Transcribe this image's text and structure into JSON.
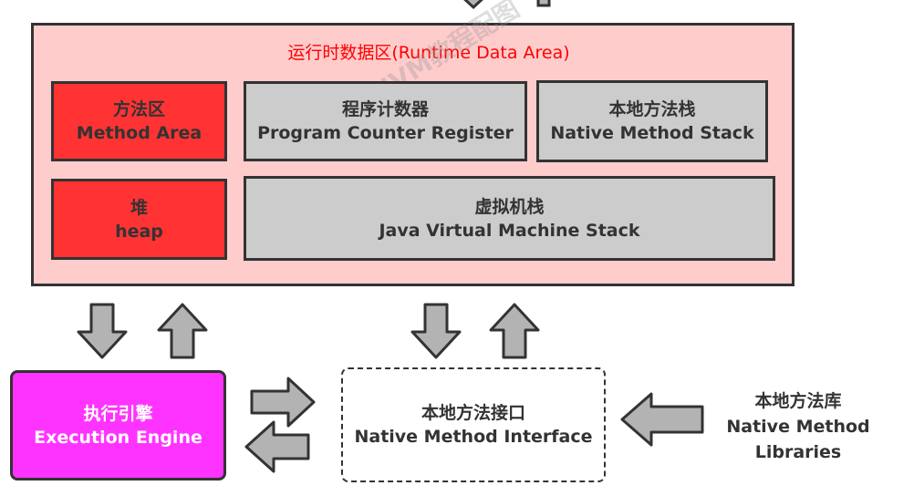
{
  "runtime_area": {
    "title": "运行时数据区(Runtime Data Area)"
  },
  "method_area": {
    "cn": "方法区",
    "en": "Method Area"
  },
  "pc_register": {
    "cn": "程序计数器",
    "en": "Program Counter Register"
  },
  "native_stack": {
    "cn": "本地方法栈",
    "en": "Native Method Stack"
  },
  "heap": {
    "cn": "堆",
    "en": "heap"
  },
  "jvm_stack": {
    "cn": "虚拟机栈",
    "en": "Java Virtual Machine Stack"
  },
  "execution_engine": {
    "cn": "执行引擎",
    "en": "Execution Engine"
  },
  "native_interface": {
    "cn": "本地方法接口",
    "en": "Native Method Interface"
  },
  "native_libraries": {
    "cn": "本地方法库",
    "en_line1": "Native Method",
    "en_line2": "Libraries"
  },
  "watermark": {
    "text": "尚硅谷JVM教程配图"
  },
  "colors": {
    "runtime_bg": "#ffcccc",
    "title_red": "#ff0000",
    "red_box": "#ff3333",
    "gray_box": "#cccccc",
    "engine": "#ff33ff",
    "arrow_fill": "#b3b3b3",
    "outline": "#333333"
  }
}
